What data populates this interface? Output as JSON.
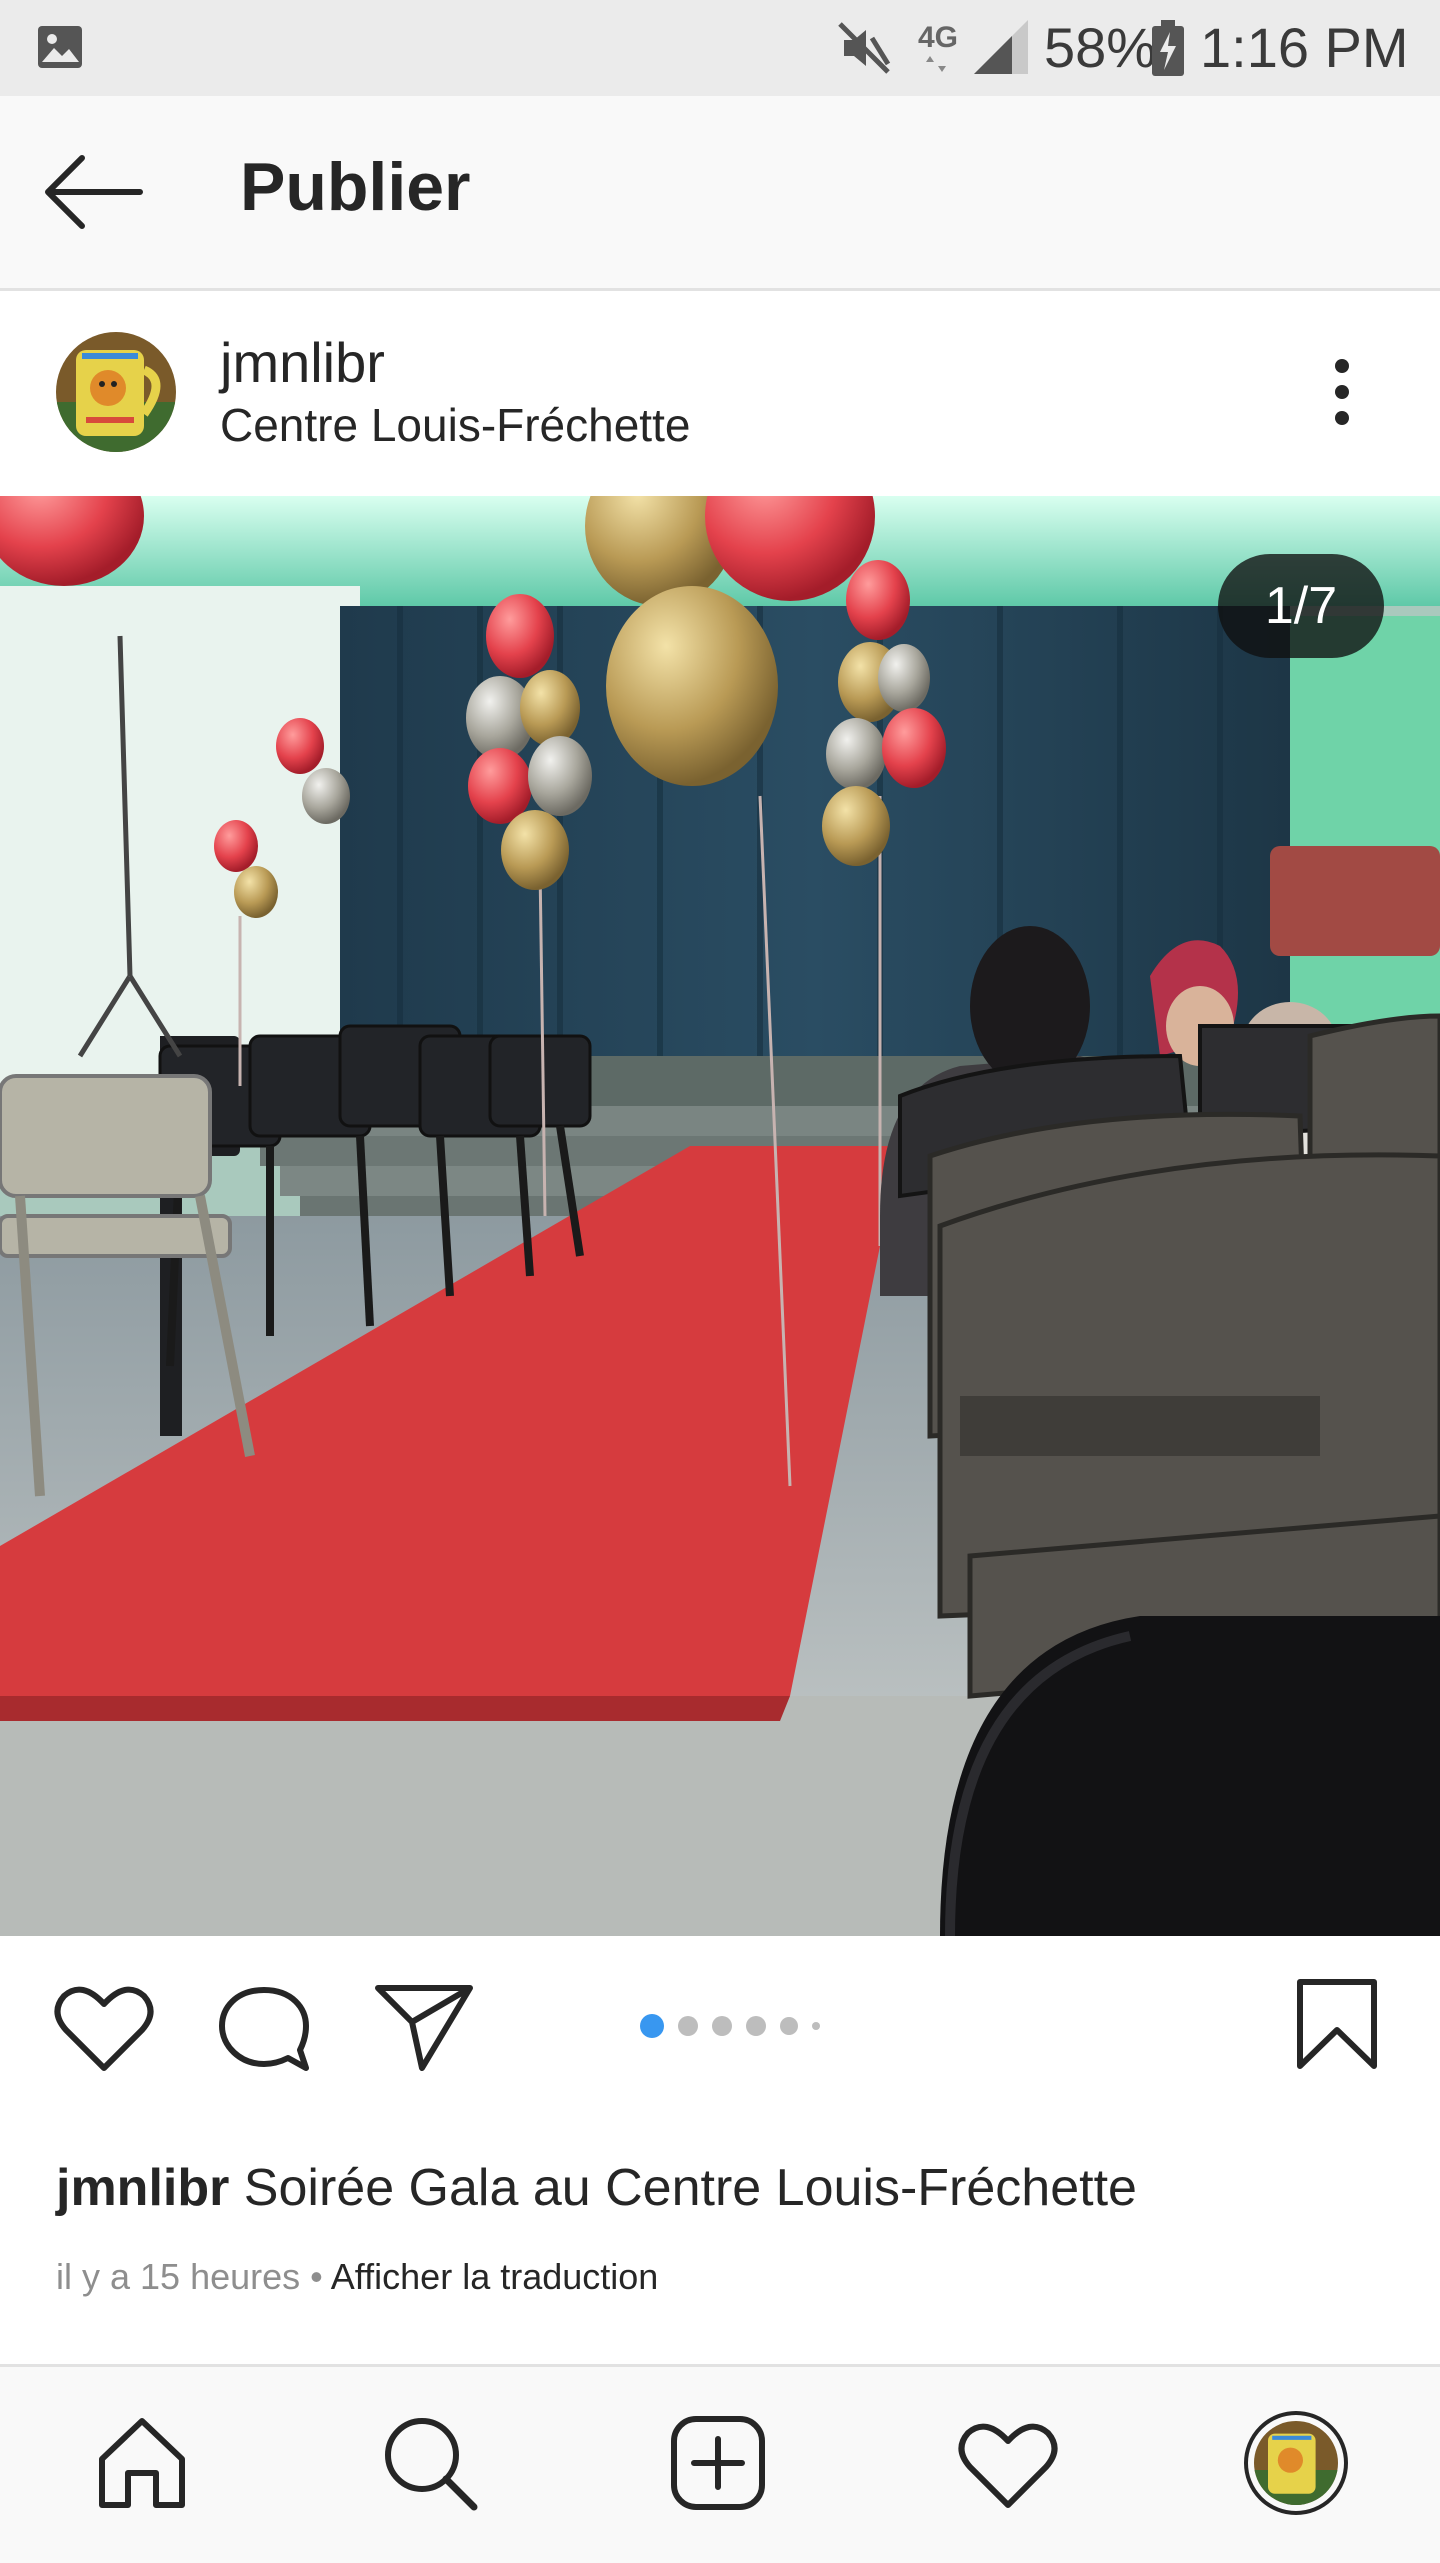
{
  "status_bar": {
    "network": "4G",
    "battery": "58%",
    "time": "1:16 PM",
    "icons": [
      "gallery-icon",
      "mute-icon",
      "signal-icon",
      "battery-icon"
    ]
  },
  "header": {
    "title": "Publier"
  },
  "post": {
    "username": "jmnlibr",
    "location": "Centre Louis-Fréchette",
    "counter": "1/7",
    "carousel": {
      "total_visible_dots": 6,
      "active_index": 0
    },
    "caption_user": "jmnlibr",
    "caption_text": "Soirée Gala au Centre Louis-Fréchette",
    "timestamp": "il y a 15 heures",
    "separator": "•",
    "translate_label": "Afficher la traduction"
  },
  "colors": {
    "accent": "#3897f0",
    "text": "#262626",
    "muted": "#8e8e8e",
    "carpet": "#d43a3a"
  },
  "bottom_nav": {
    "items": [
      "home-icon",
      "search-icon",
      "add-post-icon",
      "activity-icon",
      "profile-avatar"
    ]
  }
}
